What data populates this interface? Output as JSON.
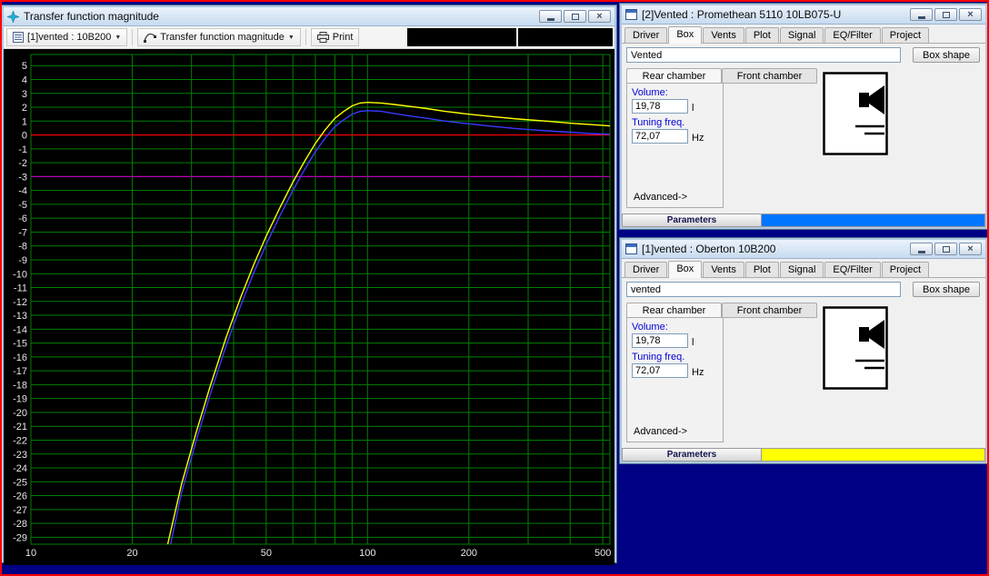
{
  "colors": {
    "desktop_bg": "#000084",
    "screen_border": "#ff0000",
    "plot_background": "#000000",
    "grid_green": "#008000",
    "axis_text": "#e8e8e8"
  },
  "plot_window": {
    "title": "Transfer function magnitude",
    "toolbar": {
      "project_selector": "[1]vented : 10B200",
      "plot_type_selector": "Transfer function magnitude",
      "print_label": "Print"
    }
  },
  "chart_data": {
    "type": "line",
    "title": "Transfer function magnitude",
    "xlabel": "",
    "ylabel": "",
    "xscale": "log",
    "xlim": [
      10,
      525
    ],
    "ylim": [
      -29.5,
      5.8
    ],
    "grid": true,
    "grid_color": "#008000",
    "background": "#000000",
    "x_tick_labels": [
      10,
      20,
      50,
      100,
      200,
      500
    ],
    "x_gridlines": [
      10,
      20,
      30,
      40,
      50,
      60,
      70,
      80,
      90,
      100,
      200,
      300,
      400,
      500
    ],
    "y_ticks": [
      5,
      4,
      3,
      2,
      1,
      0,
      -1,
      -2,
      -3,
      -4,
      -5,
      -6,
      -7,
      -8,
      -9,
      -10,
      -11,
      -12,
      -13,
      -14,
      -15,
      -16,
      -17,
      -18,
      -19,
      -20,
      -21,
      -22,
      -23,
      -24,
      -25,
      -26,
      -27,
      -28,
      -29
    ],
    "reference_lines": [
      {
        "y": 0,
        "color": "#ff0000",
        "name": "0 dB reference line"
      },
      {
        "y": -3,
        "color": "#b400b4",
        "name": "-3 dB line"
      }
    ],
    "series": [
      {
        "name": "[2]Vented : Promethean 5110 10LB075-U",
        "color": "#3a3aff",
        "points": [
          [
            26,
            -29.5
          ],
          [
            28,
            -25.8
          ],
          [
            31,
            -22.0
          ],
          [
            34,
            -18.8
          ],
          [
            38,
            -15.2
          ],
          [
            42,
            -12.3
          ],
          [
            46,
            -9.9
          ],
          [
            50,
            -7.9
          ],
          [
            55,
            -5.8
          ],
          [
            60,
            -4.0
          ],
          [
            65,
            -2.5
          ],
          [
            70,
            -1.2
          ],
          [
            75,
            -0.2
          ],
          [
            80,
            0.6
          ],
          [
            85,
            1.1
          ],
          [
            90,
            1.5
          ],
          [
            95,
            1.7
          ],
          [
            100,
            1.75
          ],
          [
            110,
            1.7
          ],
          [
            120,
            1.55
          ],
          [
            135,
            1.35
          ],
          [
            150,
            1.2
          ],
          [
            170,
            1.0
          ],
          [
            200,
            0.8
          ],
          [
            240,
            0.6
          ],
          [
            280,
            0.45
          ],
          [
            340,
            0.3
          ],
          [
            400,
            0.2
          ],
          [
            460,
            0.1
          ],
          [
            525,
            0.05
          ]
        ]
      },
      {
        "name": "[1]vented : Oberton 10B200",
        "color": "#ffff00",
        "points": [
          [
            25.5,
            -29.5
          ],
          [
            28,
            -25.2
          ],
          [
            31,
            -21.4
          ],
          [
            34,
            -18.2
          ],
          [
            38,
            -14.6
          ],
          [
            42,
            -11.7
          ],
          [
            46,
            -9.3
          ],
          [
            50,
            -7.3
          ],
          [
            55,
            -5.2
          ],
          [
            60,
            -3.4
          ],
          [
            65,
            -1.9
          ],
          [
            70,
            -0.6
          ],
          [
            75,
            0.4
          ],
          [
            80,
            1.2
          ],
          [
            85,
            1.7
          ],
          [
            90,
            2.1
          ],
          [
            95,
            2.3
          ],
          [
            100,
            2.35
          ],
          [
            110,
            2.3
          ],
          [
            120,
            2.2
          ],
          [
            135,
            2.05
          ],
          [
            150,
            1.9
          ],
          [
            170,
            1.7
          ],
          [
            200,
            1.5
          ],
          [
            240,
            1.3
          ],
          [
            280,
            1.15
          ],
          [
            340,
            1.0
          ],
          [
            400,
            0.85
          ],
          [
            460,
            0.75
          ],
          [
            525,
            0.65
          ]
        ]
      }
    ]
  },
  "windows": [
    {
      "title": "[2]Vented : Promethean 5110 10LB075-U",
      "tabs": [
        "Driver",
        "Box",
        "Vents",
        "Plot",
        "Signal",
        "EQ/Filter",
        "Project"
      ],
      "active_tab": "Box",
      "box_type_value": "Vented",
      "box_shape_button": "Box shape",
      "chamber_tabs": [
        "Rear chamber",
        "Front chamber"
      ],
      "volume_label": "Volume:",
      "volume_value": "19,78",
      "volume_unit": "l",
      "tuning_label": "Tuning freq.",
      "tuning_value": "72,07",
      "tuning_unit": "Hz",
      "advanced_label": "Advanced->",
      "parameters_label": "Parameters",
      "parameters_bar_color": "#0075ff"
    },
    {
      "title": "[1]vented : Oberton 10B200",
      "tabs": [
        "Driver",
        "Box",
        "Vents",
        "Plot",
        "Signal",
        "EQ/Filter",
        "Project"
      ],
      "active_tab": "Box",
      "box_type_value": "vented",
      "box_shape_button": "Box shape",
      "chamber_tabs": [
        "Rear chamber",
        "Front chamber"
      ],
      "volume_label": "Volume:",
      "volume_value": "19,78",
      "volume_unit": "l",
      "tuning_label": "Tuning freq.",
      "tuning_value": "72,07",
      "tuning_unit": "Hz",
      "advanced_label": "Advanced->",
      "parameters_label": "Parameters",
      "parameters_bar_color": "#ffff00"
    }
  ]
}
